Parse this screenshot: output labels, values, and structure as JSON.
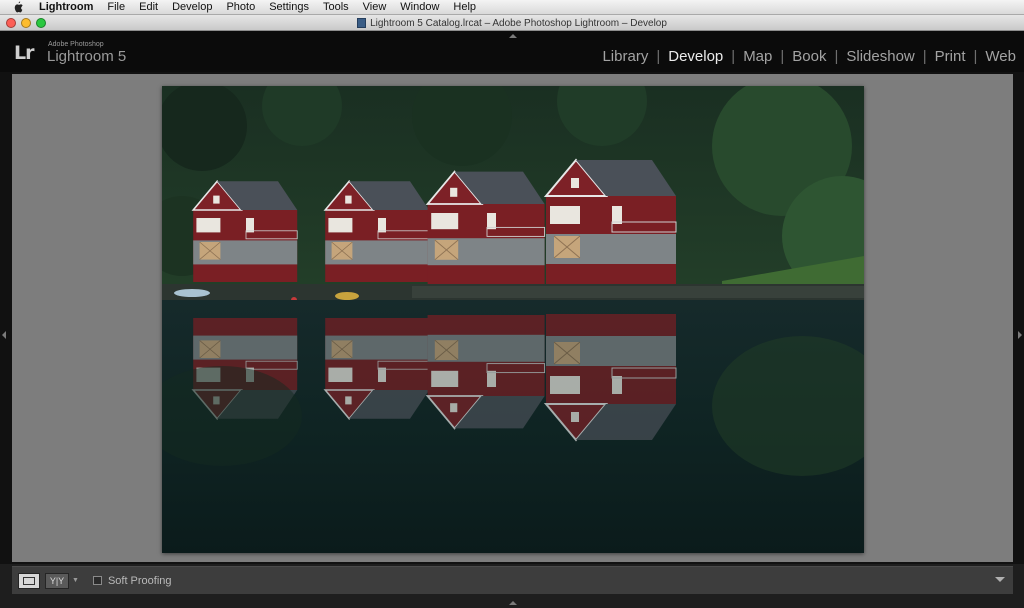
{
  "menubar": {
    "app_name": "Lightroom",
    "items": [
      "File",
      "Edit",
      "Develop",
      "Photo",
      "Settings",
      "Tools",
      "View",
      "Window",
      "Help"
    ]
  },
  "window": {
    "title": "Lightroom 5 Catalog.lrcat – Adobe Photoshop Lightroom – Develop"
  },
  "identity": {
    "logo": "Lr",
    "vendor": "Adobe Photoshop",
    "product": "Lightroom 5"
  },
  "modules": {
    "active": "Develop",
    "items": [
      "Library",
      "Develop",
      "Map",
      "Book",
      "Slideshow",
      "Print",
      "Web"
    ]
  },
  "toolbar": {
    "before_after_label": "Y|Y",
    "soft_proofing_label": "Soft Proofing"
  },
  "colors": {
    "house_red": "#7a1f24",
    "roof": "#4a5058",
    "water": "#0f2522",
    "forest": "#1d3a24",
    "canvas_gray": "#7d7d7d"
  },
  "icons": [
    "apple-icon",
    "document-icon",
    "loupe-view-icon",
    "before-after-icon",
    "panel-collapse-arrow-icon"
  ]
}
